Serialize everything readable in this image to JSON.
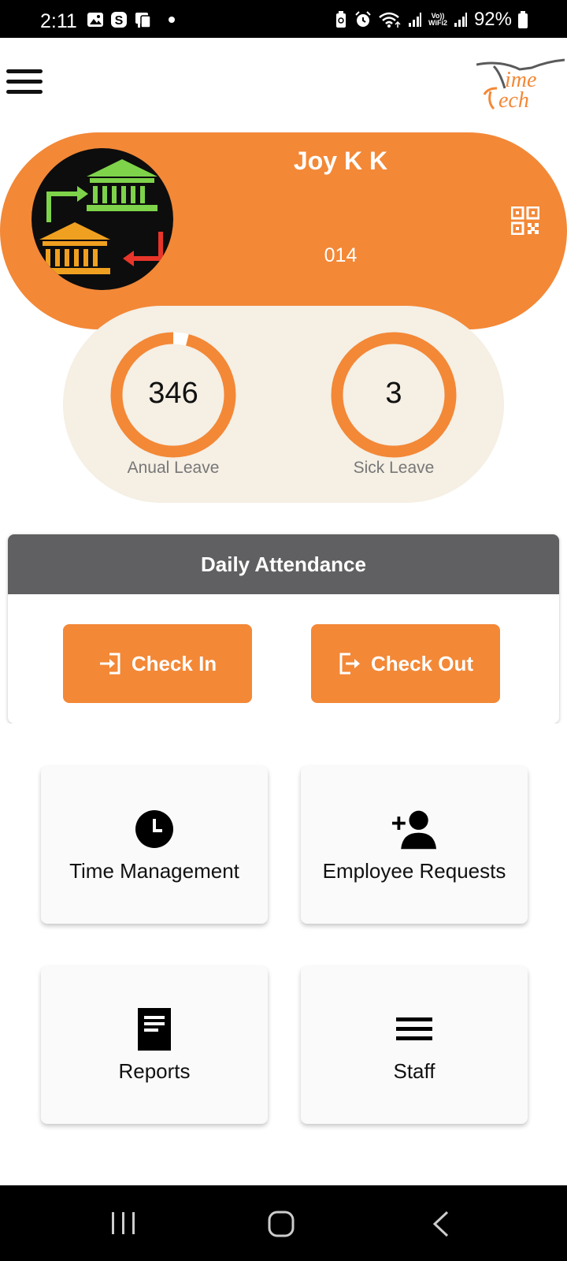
{
  "status_bar": {
    "time": "2:11",
    "battery": "92%",
    "volte_line1": "Vo))",
    "volte_line2": "WiFi2"
  },
  "header": {
    "menu_icon": "hamburger-menu-icon",
    "logo_line1": "ime",
    "logo_line2": "ech"
  },
  "profile": {
    "name": "Joy K K",
    "id": "014",
    "qr_icon": "qr-code-icon"
  },
  "leaves": {
    "annual": {
      "value": "346",
      "label": "Anual Leave",
      "fill_fraction": 0.96
    },
    "sick": {
      "value": "3",
      "label": "Sick Leave",
      "fill_fraction": 1.0
    }
  },
  "attendance": {
    "title": "Daily Attendance",
    "check_in_label": "Check In",
    "check_out_label": "Check Out"
  },
  "menu_tiles": [
    {
      "label": "Time Management",
      "icon": "clock-icon"
    },
    {
      "label": "Employee Requests",
      "icon": "add-person-icon"
    },
    {
      "label": "Reports",
      "icon": "document-icon"
    },
    {
      "label": "Staff",
      "icon": "list-icon"
    }
  ],
  "colors": {
    "accent": "#f38837",
    "panel": "#f5efe4",
    "card_header": "#606062"
  }
}
